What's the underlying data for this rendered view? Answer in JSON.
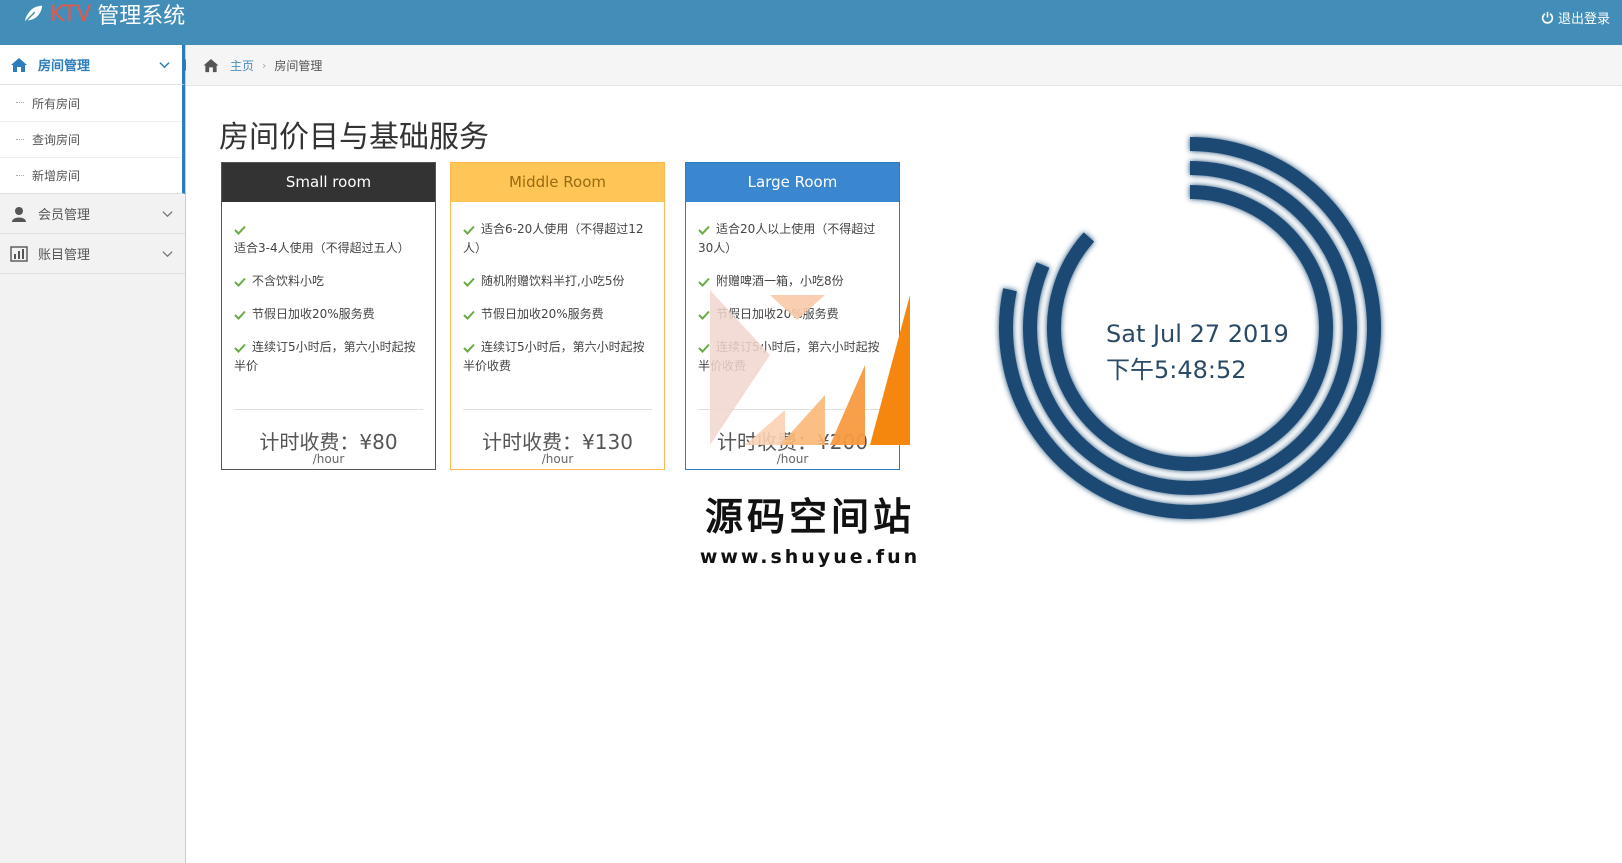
{
  "header": {
    "brand_prefix": "KTV",
    "brand_suffix": "管理系统",
    "logout": "退出登录",
    "colors": {
      "bar": "#438eb9",
      "accent": "#e05a4a"
    }
  },
  "sidebar": {
    "groups": [
      {
        "label": "房间管理",
        "icon": "home-icon",
        "active": true,
        "items": [
          {
            "label": "所有房间"
          },
          {
            "label": "查询房间"
          },
          {
            "label": "新增房间"
          }
        ]
      },
      {
        "label": "会员管理",
        "icon": "user-icon",
        "active": false
      },
      {
        "label": "账目管理",
        "icon": "bar-chart-icon",
        "active": false
      }
    ]
  },
  "breadcrumb": {
    "home": "主页",
    "current": "房间管理"
  },
  "page": {
    "title": "房间价目与基础服务",
    "cards": [
      {
        "name": "Small room",
        "color": "#333333",
        "features": [
          "适合3-4人使用（不得超过五人）",
          "不含饮料小吃",
          "节假日加收20%服务费",
          "连续订5小时后，第六小时起按半价"
        ],
        "price": "计时收费：¥80",
        "unit": "/hour"
      },
      {
        "name": "Middle Room",
        "color": "#ffc657",
        "features": [
          "适合6-20人使用（不得超过12人）",
          "随机附赠饮料半打,小吃5份",
          "节假日加收20%服务费",
          "连续订5小时后，第六小时起按半价收费"
        ],
        "price": "计时收费：¥130",
        "unit": "/hour"
      },
      {
        "name": "Large Room",
        "color": "#3a87cf",
        "features": [
          "适合20人以上使用（不得超过30人）",
          "附赠啤酒一箱，小吃8份",
          "节假日加收20%服务费",
          "连续订5小时后，第六小时起按半价收费"
        ],
        "price": "计时收费：¥200",
        "unit": "/hour"
      }
    ]
  },
  "clock": {
    "date": "Sat Jul 27 2019",
    "time": "下午5:48:52",
    "ring_color": "#1c4a73",
    "hours": 5,
    "minutes": 48,
    "seconds": 52
  },
  "watermark": {
    "name": "源码空间站",
    "url": "www.shuyue.fun"
  }
}
